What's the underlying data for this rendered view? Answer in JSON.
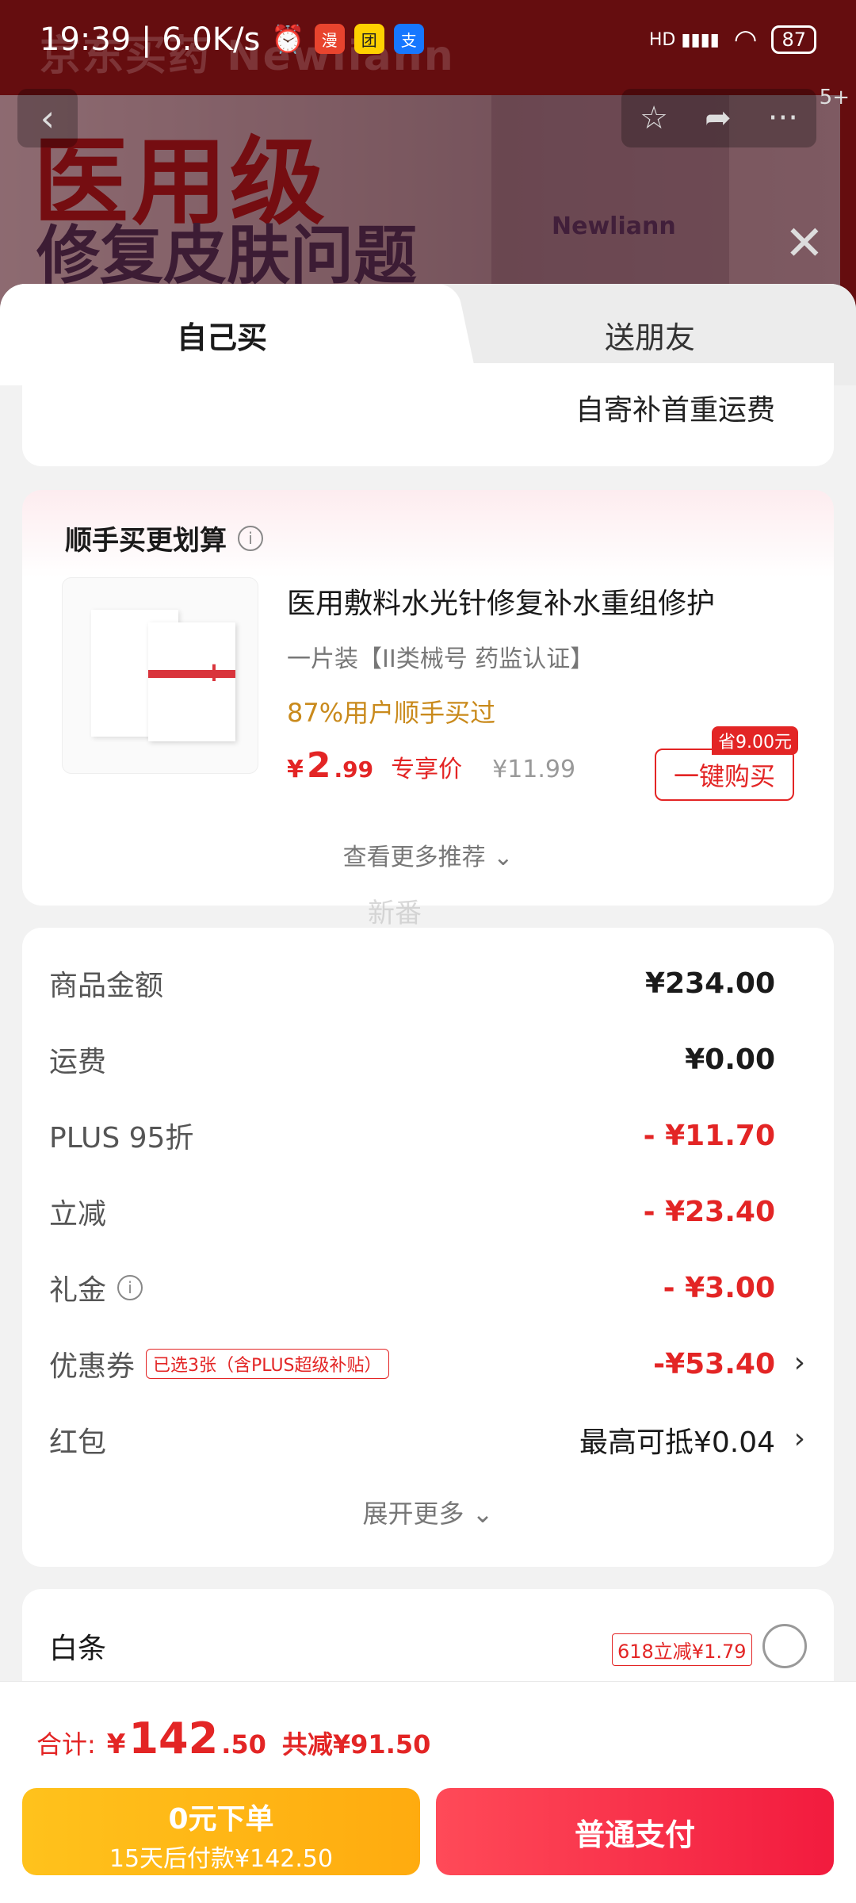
{
  "status": {
    "time": "19:39",
    "speed": "6.0K/s",
    "battery": "87",
    "signal": "HD"
  },
  "banner": {
    "faded_title": "京东买药 Newliann",
    "headline": "医用级",
    "subline": "修复皮肤问题",
    "brand": "Newliann",
    "nav_count": "5+"
  },
  "tabs": {
    "self": "自己买",
    "friend": "送朋友"
  },
  "shipping": {
    "text": "自寄补首重运费"
  },
  "recommend": {
    "title": "顺手买更划算",
    "product_name": "医用敷料水光针修复补水重组修护",
    "spec": "一片装【II类械号 药监认证】",
    "popularity": "87%用户顺手买过",
    "price_currency": "¥",
    "price_int": "2",
    "price_dec": ".99",
    "price_label": "专享价",
    "original_price": "¥11.99",
    "save_tag": "省9.00元",
    "buy_button": "一键购买",
    "more": "查看更多推荐 ⌄"
  },
  "watermark": "新番",
  "summary": {
    "rows": [
      {
        "label": "商品金额",
        "value": "¥234.00"
      },
      {
        "label": "运费",
        "value": "¥0.00"
      },
      {
        "label": "PLUS 95折",
        "value": "- ¥11.70"
      },
      {
        "label": "立减",
        "value": "- ¥23.40"
      },
      {
        "label": "礼金",
        "value": "- ¥3.00"
      },
      {
        "label": "优惠券",
        "value": "-¥53.40",
        "tag": "已选3张（含PLUS超级补贴）"
      },
      {
        "label": "红包",
        "value": "最高可抵¥0.04"
      }
    ],
    "expand": "展开更多 ⌄"
  },
  "payment": {
    "method": "白条",
    "promo": "618立减¥1.79"
  },
  "footer": {
    "total_label": "合计:",
    "currency": "¥",
    "total_int": "142",
    "total_dec": ".50",
    "discount": "共减¥91.50",
    "credit_title": "0元下单",
    "credit_sub": "15天后付款¥142.50",
    "pay_button": "普通支付"
  },
  "colors": {
    "accent_red": "#e32525",
    "credit_yellow": "#ffb414",
    "pay_red": "#f5283f"
  }
}
